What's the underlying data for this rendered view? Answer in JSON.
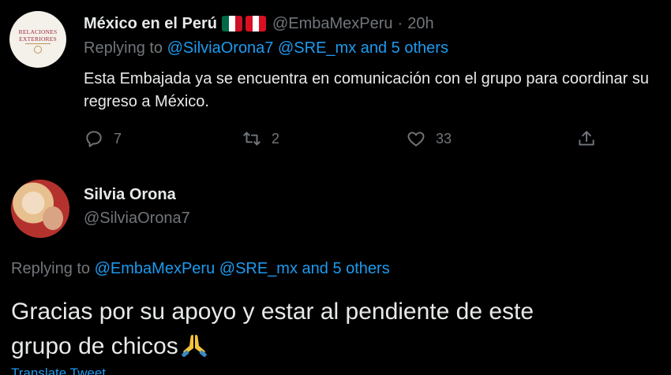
{
  "tweet1": {
    "display_name": "México en el Perú",
    "handle": "@EmbaMexPeru",
    "separator": "·",
    "time": "20h",
    "avatar_text": "RELACIONES EXTERIORES",
    "flags": [
      {
        "name": "mexico-flag",
        "colors": [
          "#006847",
          "#ffffff",
          "#ce1126"
        ]
      },
      {
        "name": "peru-flag",
        "colors": [
          "#d91023",
          "#ffffff",
          "#d91023"
        ]
      }
    ],
    "replying_prefix": "Replying to ",
    "replying_mentions": "@SilviaOrona7 @SRE_mx and 5 others",
    "text": "Esta Embajada ya se encuentra en comunicación con el grupo para coordinar su regreso a México.",
    "actions": {
      "reply_count": "7",
      "retweet_count": "2",
      "like_count": "33",
      "icons": [
        "reply-icon",
        "retweet-icon",
        "like-icon",
        "share-icon"
      ]
    }
  },
  "tweet2": {
    "display_name": "Silvia Orona",
    "handle": "@SilviaOrona7",
    "replying_prefix": "Replying to ",
    "replying_mentions": "@EmbaMexPeru @SRE_mx and 5 others",
    "text_line1": "Gracias  por su apoyo y estar al pendiente de este",
    "text_line2": "grupo de chicos",
    "emoji": "folded-hands-icon",
    "translate_label": "Translate Tweet"
  },
  "colors": {
    "background": "#000000",
    "text": "#e7e9ea",
    "muted": "#71767b",
    "accent": "#1d9bf0"
  }
}
